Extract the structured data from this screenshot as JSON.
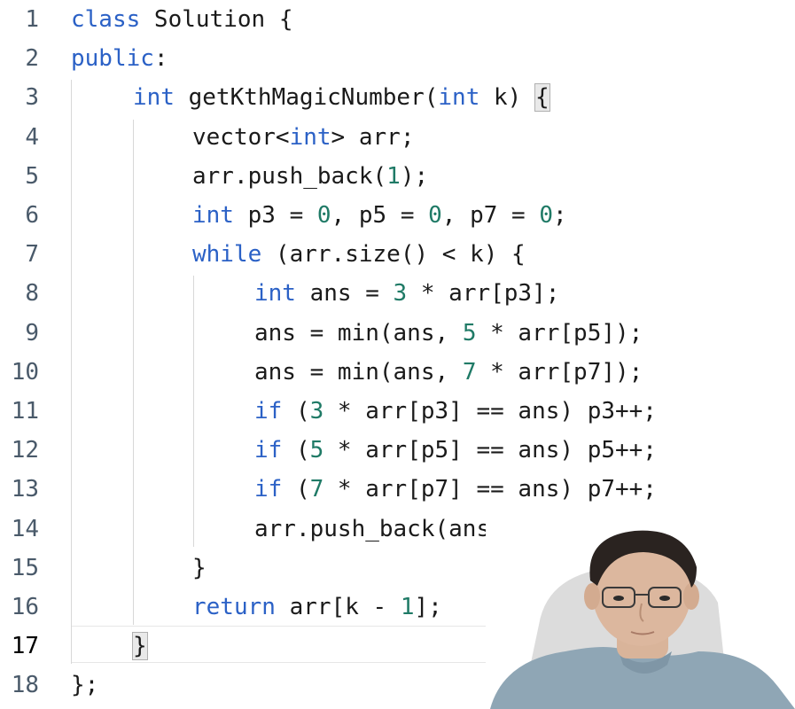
{
  "editor": {
    "current_line": 17,
    "lines": [
      {
        "number": "1",
        "tokens": [
          {
            "t": "class",
            "c": "kw"
          },
          {
            "t": " Solution {",
            "c": "plain"
          }
        ]
      },
      {
        "number": "2",
        "tokens": [
          {
            "t": "public",
            "c": "kw"
          },
          {
            "t": ":",
            "c": "plain"
          }
        ]
      },
      {
        "number": "3",
        "tokens": [
          {
            "t": "int",
            "c": "kw"
          },
          {
            "t": " getKthMagicNumber(",
            "c": "plain"
          },
          {
            "t": "int",
            "c": "kw"
          },
          {
            "t": " k) ",
            "c": "plain"
          },
          {
            "t": "{",
            "c": "brace"
          }
        ]
      },
      {
        "number": "4",
        "tokens": [
          {
            "t": "vector<",
            "c": "plain"
          },
          {
            "t": "int",
            "c": "kw"
          },
          {
            "t": "> arr;",
            "c": "plain"
          }
        ]
      },
      {
        "number": "5",
        "tokens": [
          {
            "t": "arr.push_back(",
            "c": "plain"
          },
          {
            "t": "1",
            "c": "num"
          },
          {
            "t": ");",
            "c": "plain"
          }
        ]
      },
      {
        "number": "6",
        "tokens": [
          {
            "t": "int",
            "c": "kw"
          },
          {
            "t": " p3 = ",
            "c": "plain"
          },
          {
            "t": "0",
            "c": "num"
          },
          {
            "t": ", p5 = ",
            "c": "plain"
          },
          {
            "t": "0",
            "c": "num"
          },
          {
            "t": ", p7 = ",
            "c": "plain"
          },
          {
            "t": "0",
            "c": "num"
          },
          {
            "t": ";",
            "c": "plain"
          }
        ]
      },
      {
        "number": "7",
        "tokens": [
          {
            "t": "while",
            "c": "kw"
          },
          {
            "t": " (arr.size() < k) {",
            "c": "plain"
          }
        ]
      },
      {
        "number": "8",
        "tokens": [
          {
            "t": "int",
            "c": "kw"
          },
          {
            "t": " ans = ",
            "c": "plain"
          },
          {
            "t": "3",
            "c": "num"
          },
          {
            "t": " * arr[p3];",
            "c": "plain"
          }
        ]
      },
      {
        "number": "9",
        "tokens": [
          {
            "t": "ans = min(ans, ",
            "c": "plain"
          },
          {
            "t": "5",
            "c": "num"
          },
          {
            "t": " * arr[p5]);",
            "c": "plain"
          }
        ]
      },
      {
        "number": "10",
        "tokens": [
          {
            "t": "ans = min(ans, ",
            "c": "plain"
          },
          {
            "t": "7",
            "c": "num"
          },
          {
            "t": " * arr[p7]);",
            "c": "plain"
          }
        ]
      },
      {
        "number": "11",
        "tokens": [
          {
            "t": "if",
            "c": "kw"
          },
          {
            "t": " (",
            "c": "plain"
          },
          {
            "t": "3",
            "c": "num"
          },
          {
            "t": " * arr[p3] == ans) p3++;",
            "c": "plain"
          }
        ]
      },
      {
        "number": "12",
        "tokens": [
          {
            "t": "if",
            "c": "kw"
          },
          {
            "t": " (",
            "c": "plain"
          },
          {
            "t": "5",
            "c": "num"
          },
          {
            "t": " * arr[p5] == ans) p5++;",
            "c": "plain"
          }
        ]
      },
      {
        "number": "13",
        "tokens": [
          {
            "t": "if",
            "c": "kw"
          },
          {
            "t": " (",
            "c": "plain"
          },
          {
            "t": "7",
            "c": "num"
          },
          {
            "t": " * arr[p7] == ans) p7++;",
            "c": "plain"
          }
        ]
      },
      {
        "number": "14",
        "tokens": [
          {
            "t": "arr.push_back(ans);",
            "c": "plain"
          }
        ]
      },
      {
        "number": "15",
        "tokens": [
          {
            "t": "}",
            "c": "plain"
          }
        ]
      },
      {
        "number": "16",
        "tokens": [
          {
            "t": "return",
            "c": "kw"
          },
          {
            "t": " arr[k - ",
            "c": "plain"
          },
          {
            "t": "1",
            "c": "num"
          },
          {
            "t": "];",
            "c": "plain"
          }
        ]
      },
      {
        "number": "17",
        "tokens": [
          {
            "t": "}",
            "c": "brace"
          }
        ]
      },
      {
        "number": "18",
        "tokens": [
          {
            "t": "};",
            "c": "plain"
          }
        ]
      }
    ]
  },
  "colors": {
    "keyword": "#2b61c6",
    "number": "#1f7a66",
    "text": "#1a1a1a",
    "line_number": "#4a5a6a"
  },
  "overlay": {
    "webcam_icon": "presenter-webcam-icon"
  }
}
